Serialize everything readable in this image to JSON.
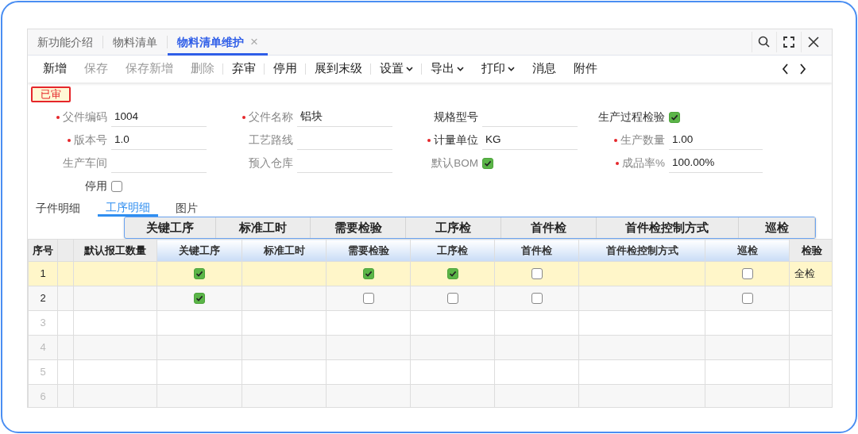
{
  "tabs": [
    {
      "label": "新功能介绍",
      "selected": false,
      "closable": false
    },
    {
      "label": "物料清单",
      "selected": false,
      "closable": false
    },
    {
      "label": "物料清单维护",
      "selected": true,
      "closable": true,
      "close_glyph": "×"
    }
  ],
  "toolbar": [
    {
      "label": "新增",
      "disabled": false,
      "dropdown": false,
      "divider_after": false
    },
    {
      "label": "保存",
      "disabled": true,
      "dropdown": false,
      "divider_after": false
    },
    {
      "label": "保存新增",
      "disabled": true,
      "dropdown": false,
      "divider_after": false
    },
    {
      "label": "删除",
      "disabled": true,
      "dropdown": false,
      "divider_after": true
    },
    {
      "label": "弃审",
      "disabled": false,
      "dropdown": false,
      "divider_after": true
    },
    {
      "label": "停用",
      "disabled": false,
      "dropdown": false,
      "divider_after": true
    },
    {
      "label": "展到末级",
      "disabled": false,
      "dropdown": false,
      "divider_after": true
    },
    {
      "label": "设置",
      "disabled": false,
      "dropdown": true,
      "divider_after": true
    },
    {
      "label": "导出",
      "disabled": false,
      "dropdown": true,
      "divider_after": false
    },
    {
      "label": "打印",
      "disabled": false,
      "dropdown": true,
      "divider_after": false
    },
    {
      "label": "消息",
      "disabled": false,
      "dropdown": false,
      "divider_after": false
    },
    {
      "label": "附件",
      "disabled": false,
      "dropdown": false,
      "divider_after": false
    }
  ],
  "status_badge": "已审",
  "fields": [
    {
      "label": "父件编码",
      "kind": "text",
      "required": true,
      "disabled": true,
      "value": "1004"
    },
    {
      "label": "父件名称",
      "kind": "text",
      "required": true,
      "disabled": true,
      "value": "铝块"
    },
    {
      "label": "规格型号",
      "kind": "text",
      "required": false,
      "disabled": false
    },
    {
      "label": "生产过程检验",
      "kind": "check",
      "required": false,
      "disabled": false,
      "checked": true
    },
    {
      "label": "版本号",
      "kind": "text",
      "required": true,
      "disabled": true,
      "value": "1.0"
    },
    {
      "label": "工艺路线",
      "kind": "text",
      "required": false,
      "disabled": true
    },
    {
      "label": "计量单位",
      "kind": "text",
      "required": true,
      "disabled": false,
      "value": "KG"
    },
    {
      "label": "生产数量",
      "kind": "text",
      "required": true,
      "disabled": true,
      "value": "1.00"
    },
    {
      "label": "生产车间",
      "kind": "text",
      "required": false,
      "disabled": true
    },
    {
      "label": "预入仓库",
      "kind": "text",
      "required": false,
      "disabled": true
    },
    {
      "label": "默认BOM",
      "kind": "check",
      "required": false,
      "disabled": true,
      "checked": true
    },
    {
      "label": "成品率%",
      "kind": "text",
      "required": true,
      "disabled": true,
      "value": "100.00%"
    },
    {
      "label": "停用",
      "kind": "check",
      "required": false,
      "disabled": false,
      "checked": false
    }
  ],
  "subtabs": [
    {
      "label": "子件明细",
      "selected": false
    },
    {
      "label": "工序明细",
      "selected": true
    },
    {
      "label": "图片",
      "selected": false
    }
  ],
  "drag_header": {
    "labels": [
      "关键工序",
      "标准工时",
      "需要检验",
      "工序检",
      "首件检",
      "首件检控制方式",
      "巡检"
    ]
  },
  "table": {
    "columns": [
      {
        "label": "序号",
        "kind": "index",
        "highlighted": false
      },
      {
        "kind": "spacer",
        "highlighted": false
      },
      {
        "label": "默认报工数量",
        "kind": "text",
        "highlighted": false
      },
      {
        "label": "关键工序",
        "kind": "check",
        "highlighted": true
      },
      {
        "label": "标准工时",
        "kind": "text",
        "highlighted": true
      },
      {
        "label": "需要检验",
        "kind": "check",
        "highlighted": true
      },
      {
        "label": "工序检",
        "kind": "check",
        "highlighted": true
      },
      {
        "label": "首件检",
        "kind": "check",
        "highlighted": true
      },
      {
        "label": "首件检控制方式",
        "kind": "text",
        "highlighted": true
      },
      {
        "label": "巡检",
        "kind": "check",
        "highlighted": true
      },
      {
        "label": "检验",
        "kind": "text",
        "highlighted": false
      }
    ],
    "rows": [
      {
        "number": "1",
        "selected": true,
        "filled": true,
        "cells": [
          {},
          {},
          {
            "checked": true
          },
          {},
          {
            "checked": true
          },
          {
            "checked": true
          },
          {
            "checked": false
          },
          {},
          {
            "checked": false
          },
          {
            "text": "全检"
          }
        ]
      },
      {
        "number": "2",
        "selected": false,
        "filled": true,
        "cells": [
          {},
          {},
          {
            "checked": true
          },
          {},
          {
            "checked": false
          },
          {
            "checked": false
          },
          {
            "checked": false
          },
          {},
          {
            "checked": false
          },
          {}
        ]
      },
      {
        "number": "3",
        "selected": false,
        "filled": false
      },
      {
        "number": "4",
        "selected": false,
        "filled": false
      },
      {
        "number": "5",
        "selected": false,
        "filled": false
      },
      {
        "number": "6",
        "selected": false,
        "filled": false
      }
    ]
  }
}
